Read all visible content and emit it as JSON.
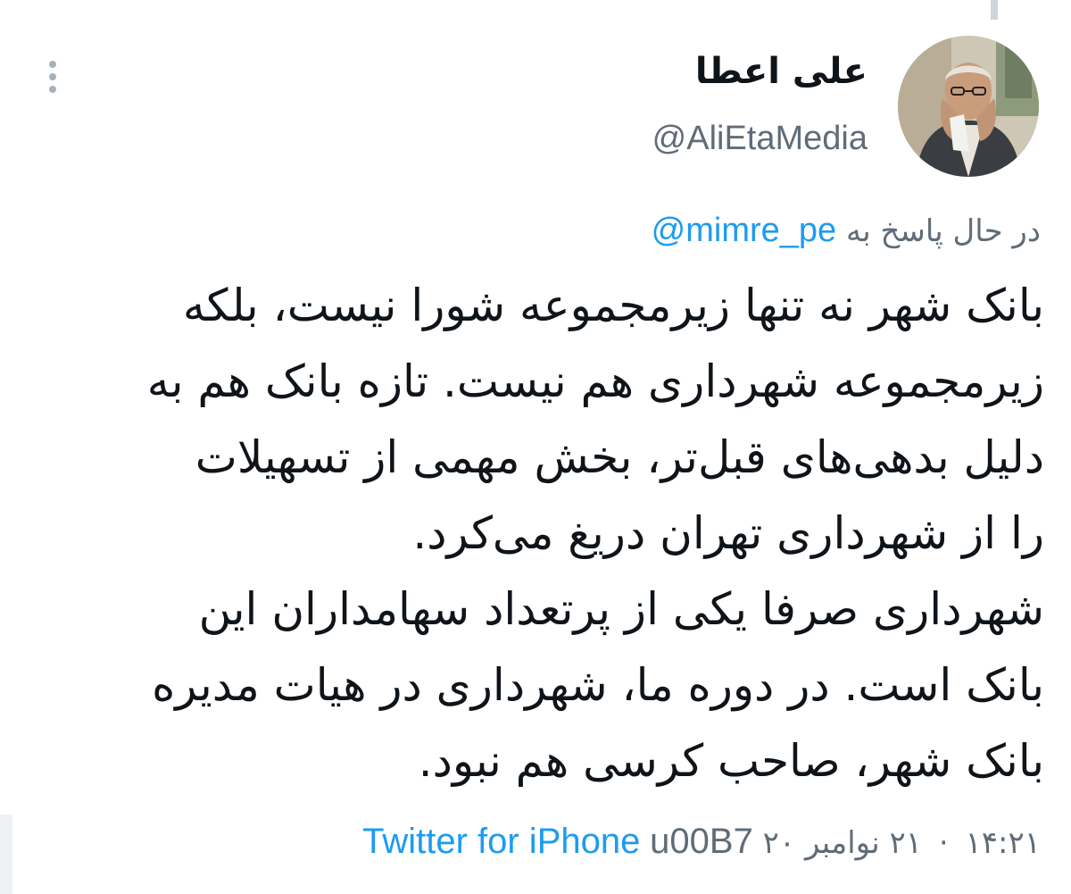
{
  "author": {
    "display_name": "علی اعطا",
    "handle": "@AliEtaMedia",
    "avatar_icon": "profile-photo"
  },
  "reply": {
    "prefix": "در حال پاسخ به",
    "mention": "@mimre_pe"
  },
  "tweet": {
    "lines": [
      "بانک شهر نه تنها زیرمجموعه شورا نیست، بلکه",
      "زیرمجموعه شهرداری هم نیست. تازه بانک هم به",
      "دلیل بدهی‌های قبل‌تر، بخش مهمی از تسهیلات",
      "را از شهرداری تهران دریغ می‌کرد.",
      "شهرداری صرفا یکی از پرتعداد سهامداران این",
      "بانک است. در دوره ما، شهرداری در هیات مدیره",
      "بانک شهر، صاحب کرسی هم نبود."
    ]
  },
  "meta": {
    "time": "۱۴:۲۱",
    "date": "۲۱ نوامبر ۲۰",
    "separator": "·",
    "source_sep": "u00B7",
    "source": "Twitter for iPhone"
  },
  "colors": {
    "accent": "#1d9bf0",
    "secondary_text": "#606c78",
    "primary_text": "#0f1419"
  }
}
